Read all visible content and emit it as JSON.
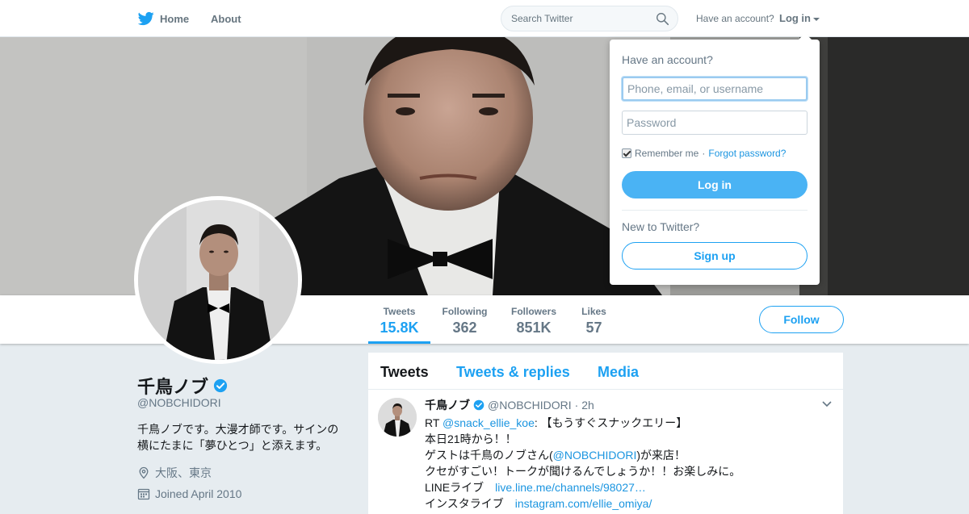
{
  "nav": {
    "home_label": "Home",
    "about_label": "About",
    "search_placeholder": "Search Twitter",
    "have_account": "Have an account?",
    "login_label": "Log in"
  },
  "profile": {
    "name": "千鳥ノブ",
    "handle": "@NOBCHIDORI",
    "bio_line1": "千鳥ノブです。大漫才師です。サインの",
    "bio_line2": "横にたまに「夢ひとつ」と添えます。",
    "location": "大阪、東京",
    "joined": "Joined April 2010"
  },
  "stats": [
    {
      "label": "Tweets",
      "value": "15.8K"
    },
    {
      "label": "Following",
      "value": "362"
    },
    {
      "label": "Followers",
      "value": "851K"
    },
    {
      "label": "Likes",
      "value": "57"
    }
  ],
  "follow_label": "Follow",
  "timeline": {
    "tabs": [
      "Tweets",
      "Tweets & replies",
      "Media"
    ],
    "tweet": {
      "name": "千鳥ノブ",
      "handle": "@NOBCHIDORI",
      "time": "· 2h",
      "rt_prefix": "RT ",
      "rt_mention": "@snack_ellie_koe",
      "rt_rest": ": 【もうすぐスナックエリー】",
      "line2": "本日21時から！！",
      "line3_pre": "ゲストは千鳥のノブさん(",
      "line3_mention": "@NOBCHIDORI",
      "line3_post": ")が来店！",
      "line4": "クセがすごい！トークが聞けるんでしょうか！！お楽しみに。",
      "line5_label": "LINEライブ　",
      "line5_link": "live.line.me/channels/98027…",
      "line6_label": "インスタライブ　",
      "line6_link": "instagram.com/ellie_omiya/"
    }
  },
  "login_dropdown": {
    "title": "Have an account?",
    "username_placeholder": "Phone, email, or username",
    "password_placeholder": "Password",
    "remember": "Remember me",
    "separator": " · ",
    "forgot": "Forgot password?",
    "login_button": "Log in",
    "new_to": "New to Twitter?",
    "signup_button": "Sign up",
    "remember_checked": true
  },
  "colors": {
    "accent": "#1da1f2",
    "link": "#1b95e0",
    "login_button": "#4ab3f4"
  }
}
